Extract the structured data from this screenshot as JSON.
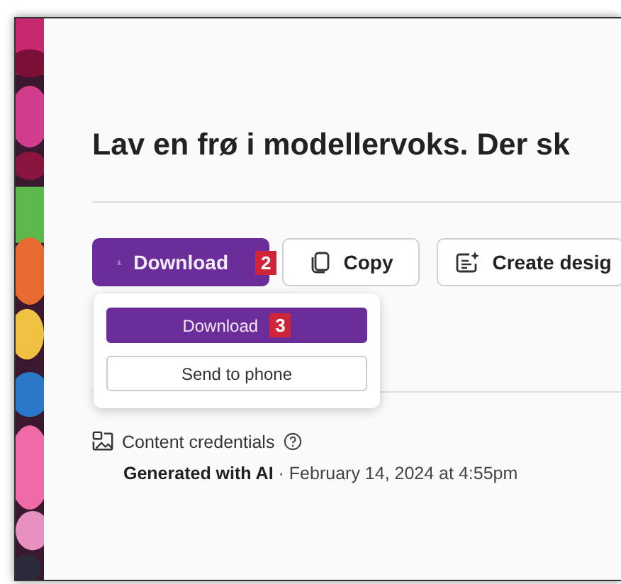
{
  "heading": "Lav en frø i modellervoks. Der sk",
  "actions": [
    {
      "label": "Download",
      "kind": "primary",
      "badge": "2"
    },
    {
      "label": "Copy",
      "kind": "copy"
    },
    {
      "label": "Create desig",
      "kind": "create"
    }
  ],
  "dropdown": {
    "items": [
      {
        "label": "Download",
        "kind": "primary",
        "badge": "3"
      },
      {
        "label": "Send to phone",
        "kind": "secondary"
      }
    ]
  },
  "credentials": {
    "label": "Content credentials",
    "detail": "**Generated with AI** · February 14, 2024 at 4:55pm"
  }
}
